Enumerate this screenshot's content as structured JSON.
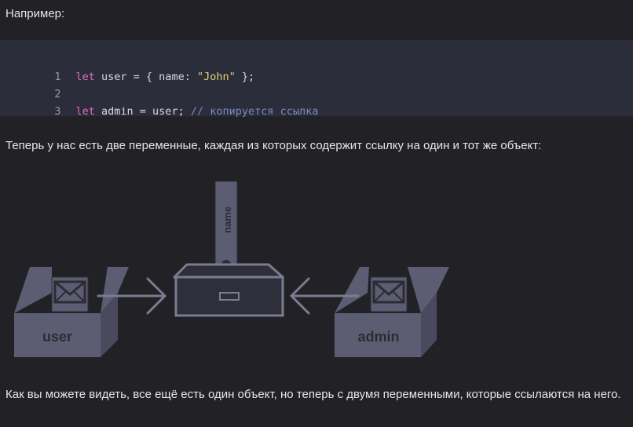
{
  "intro_text": "Например:",
  "code": {
    "lines": [
      {
        "number": "1",
        "tokens": [
          {
            "text": "let",
            "kind": "keyword"
          },
          {
            "text": " user = { name: ",
            "kind": "identifier"
          },
          {
            "text": "\"John\"",
            "kind": "string"
          },
          {
            "text": " };",
            "kind": "identifier"
          }
        ]
      },
      {
        "number": "2",
        "tokens": []
      },
      {
        "number": "3",
        "tokens": [
          {
            "text": "let",
            "kind": "keyword"
          },
          {
            "text": " admin = user; ",
            "kind": "identifier"
          },
          {
            "text": "// копируется ссылка",
            "kind": "comment"
          }
        ]
      }
    ]
  },
  "middle_text": "Теперь у нас есть две переменные, каждая из которых содержит ссылку на один и тот же объект:",
  "diagram": {
    "folder_label": "name",
    "box_left_label": "user",
    "box_right_label": "admin"
  },
  "bottom_text": "Как вы можете видеть, все ещё есть один объект, но теперь с двумя переменными, которые ссылаются на него.",
  "colors": {
    "background": "#222226",
    "code_background": "#2b2d3b",
    "keyword": "#e26bbd",
    "string": "#e3d26a",
    "comment": "#7d89c4",
    "diagram_fill": "#5c5d72",
    "diagram_stroke": "#7b7b91",
    "diagram_label": "#2c2c36"
  }
}
